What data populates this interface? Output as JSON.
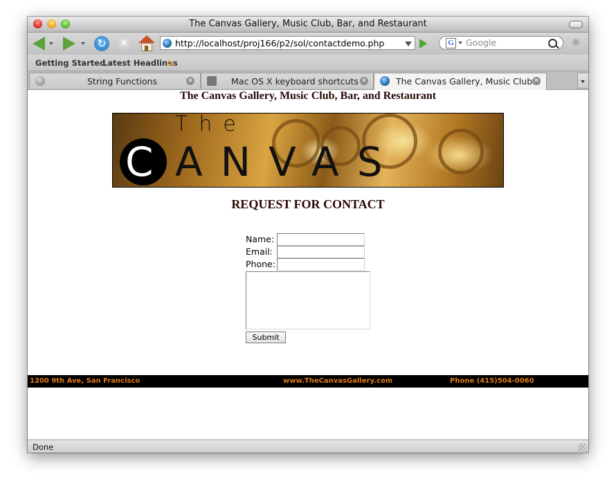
{
  "window": {
    "title": "The Canvas Gallery, Music Club, Bar, and Restaurant"
  },
  "toolbar": {
    "url": "http://localhost/proj166/p2/sol/contactdemo.php",
    "search_placeholder": "Google"
  },
  "bookmarks": [
    {
      "label": "Getting Started"
    },
    {
      "label": "Latest Headlines"
    }
  ],
  "tabs": [
    {
      "label": "String Functions"
    },
    {
      "label": "Mac OS X keyboard shortcuts"
    },
    {
      "label": "The Canvas Gallery, Music Club..."
    }
  ],
  "page": {
    "site_title": "The Canvas Gallery, Music Club, Bar, and Restaurant",
    "banner": {
      "the": "The",
      "c": "C",
      "rest": "ANVAS"
    },
    "heading": "REQUEST FOR CONTACT",
    "form": {
      "name_label": "Name:",
      "email_label": "Email:",
      "phone_label": "Phone:",
      "name_value": "",
      "email_value": "",
      "phone_value": "",
      "message_value": "",
      "submit_label": "Submit"
    },
    "footer": {
      "address": "1200 9th Ave, San Francisco",
      "website": "www.TheCanvasGallery.com",
      "phone": "Phone (415)504-0060"
    }
  },
  "status": {
    "text": "Done"
  },
  "colors": {
    "heading": "#2a0505",
    "footer_text": "#e07b1a",
    "footer_bg": "#000000"
  }
}
